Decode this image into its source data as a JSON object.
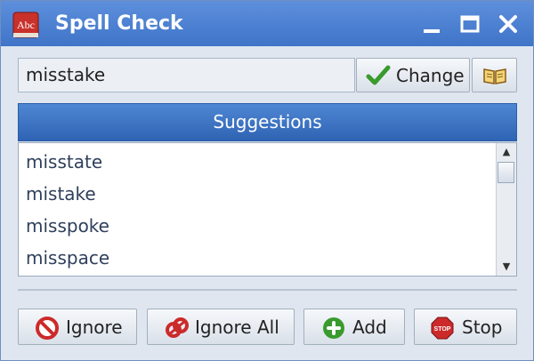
{
  "window": {
    "title": "Spell Check",
    "app_icon_text": "Abc"
  },
  "search": {
    "value": "misstake"
  },
  "toolbar": {
    "change_label": "Change"
  },
  "suggestions": {
    "header": "Suggestions",
    "items": [
      "misstate",
      "mistake",
      "misspoke",
      "misspace"
    ]
  },
  "actions": {
    "ignore": "Ignore",
    "ignore_all": "Ignore All",
    "add": "Add",
    "stop": "Stop"
  },
  "colors": {
    "titlebar": "#4a7fd0",
    "header": "#2f63b3",
    "accent_green": "#3a9a2e",
    "danger_red": "#cc2a2a"
  },
  "icons": {
    "app": "abc-book-icon",
    "change": "checkmark-icon",
    "dictionary": "open-book-icon",
    "ignore": "no-entry-icon",
    "ignore_all": "link-chain-icon",
    "add": "plus-circle-icon",
    "stop": "stop-sign-icon"
  }
}
